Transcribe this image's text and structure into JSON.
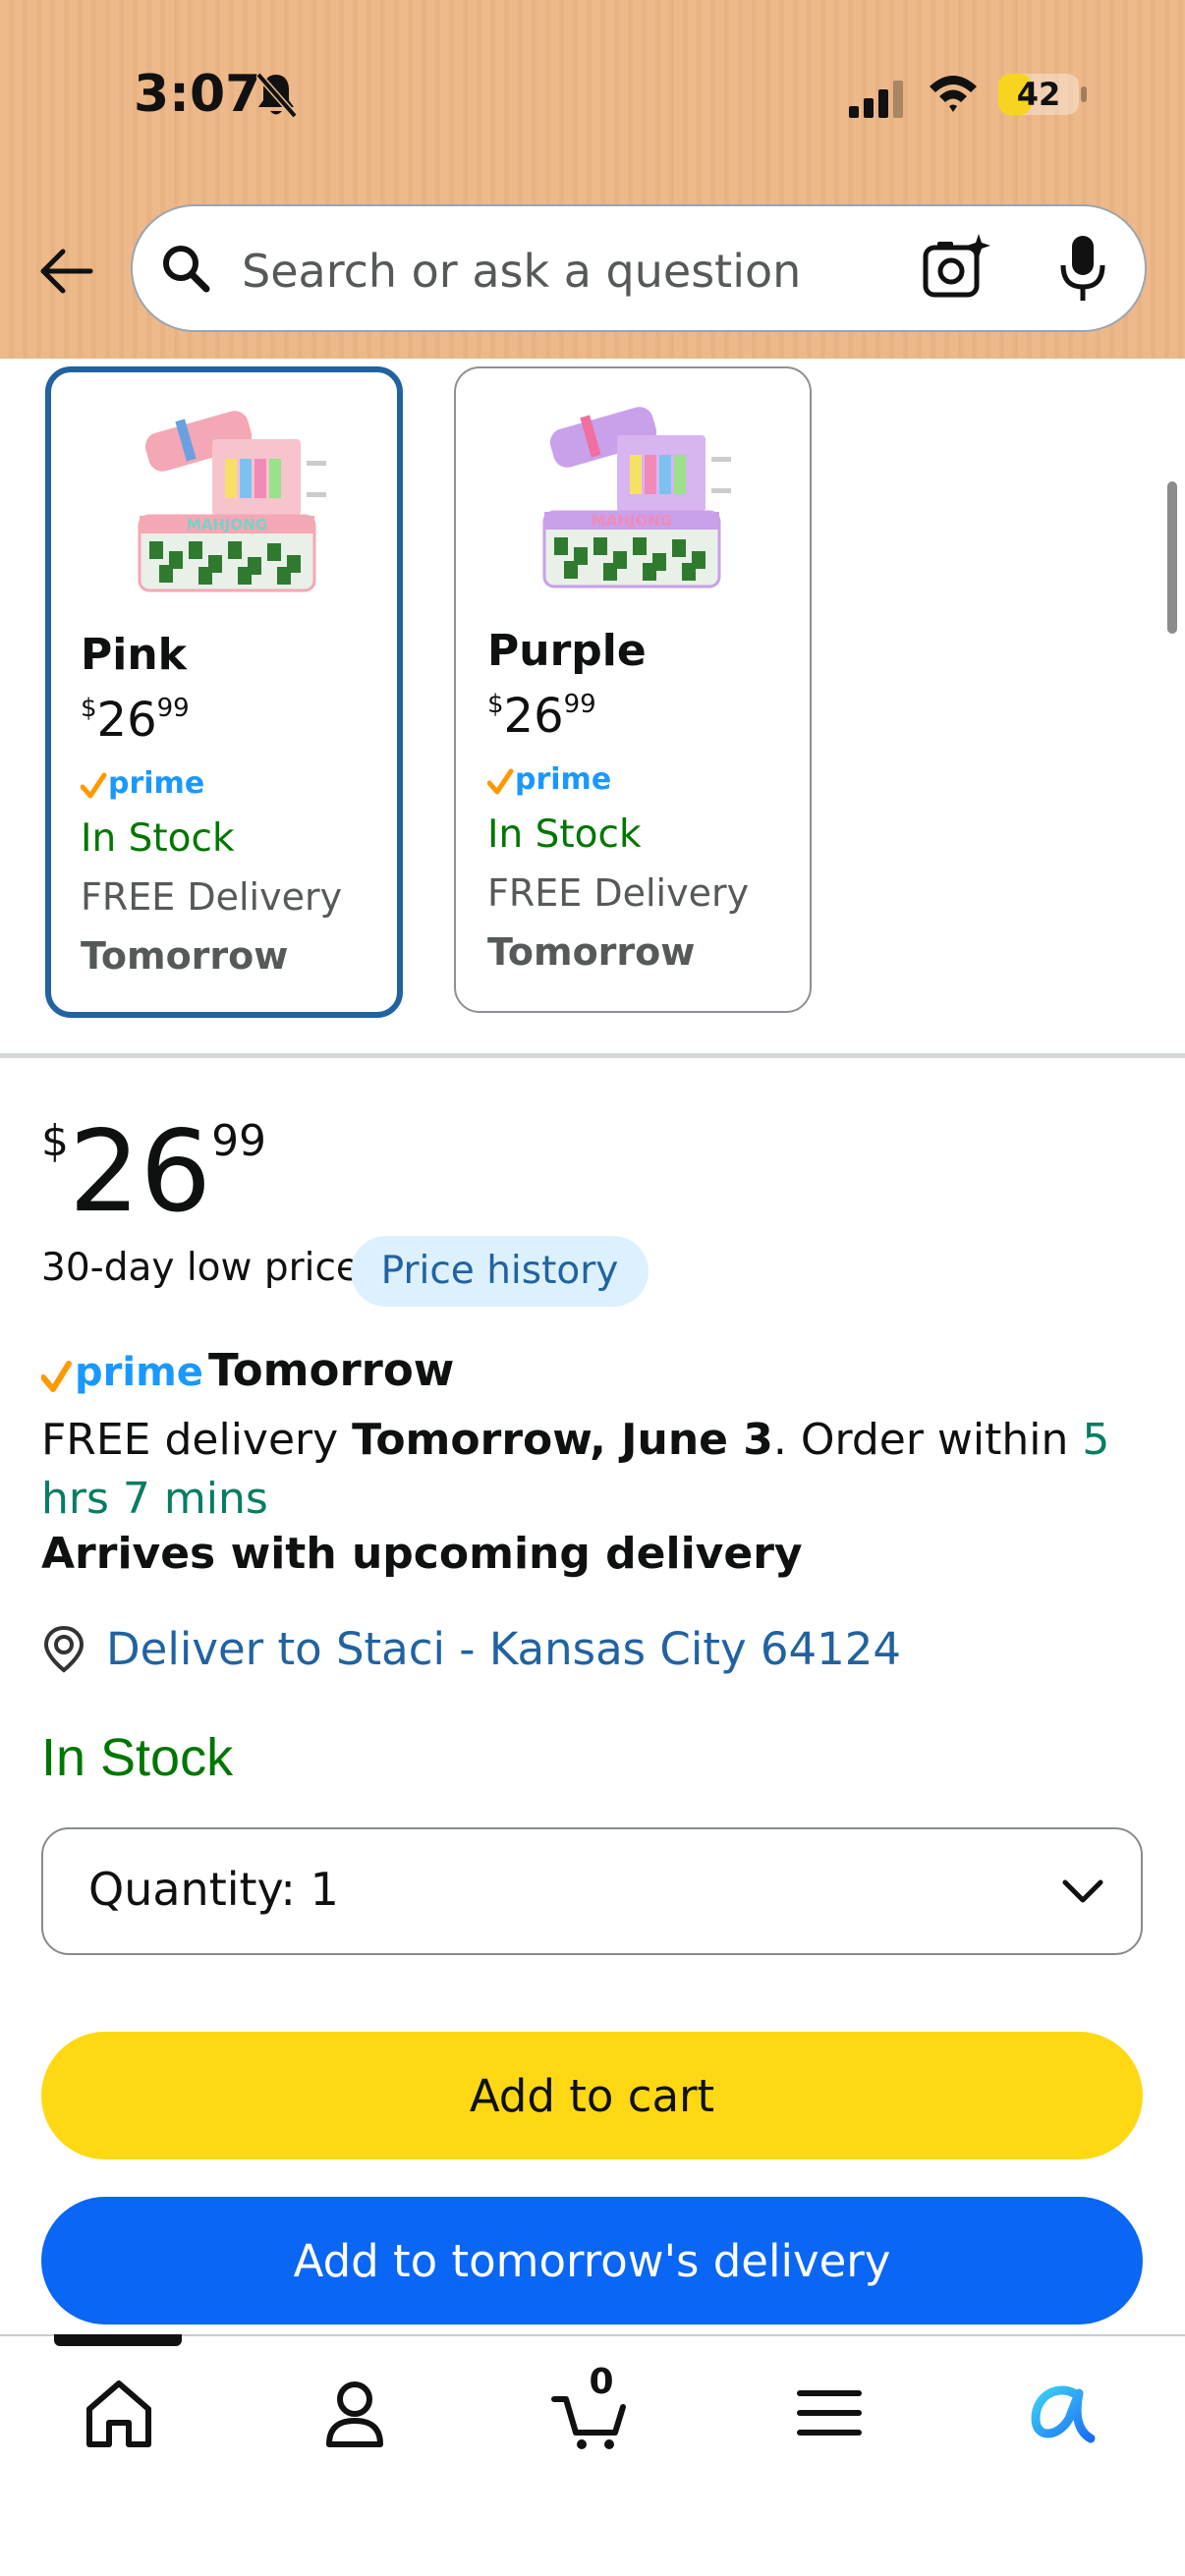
{
  "status_bar": {
    "time": "3:07",
    "battery": "42",
    "battery_level": 0.42
  },
  "search": {
    "placeholder": "Search or ask a question"
  },
  "variants": [
    {
      "name": "Pink",
      "price_symbol": "$",
      "price_whole": "26",
      "price_cents": "99",
      "stock": "In Stock",
      "delivery": "FREE Delivery",
      "delivery_day": "Tomorrow",
      "image_text": "MAHJONG",
      "selected": true
    },
    {
      "name": "Purple",
      "price_symbol": "$",
      "price_whole": "26",
      "price_cents": "99",
      "stock": "In Stock",
      "delivery": "FREE Delivery",
      "delivery_day": "Tomorrow",
      "image_text": "MAHJONG",
      "selected": false
    }
  ],
  "price": {
    "symbol": "$",
    "whole": "26",
    "cents": "99",
    "low_price_label": "30-day low price",
    "history_button": "Price history"
  },
  "delivery": {
    "prime_label": "Tomorrow",
    "line_prefix": "FREE delivery ",
    "date": "Tomorrow, June 3",
    "order_within_prefix": ". Order within ",
    "order_within": "5 hrs 7 mins",
    "arrives": "Arrives with upcoming delivery",
    "deliver_to": "Deliver to Staci - Kansas City 64124"
  },
  "stock_status": "In Stock",
  "quantity": {
    "label": "Quantity:",
    "value": "1"
  },
  "buttons": {
    "add_to_cart": "Add to cart",
    "add_to_tomorrow": "Add to tomorrow's delivery"
  },
  "bottom_nav": {
    "cart_count": "0",
    "items": [
      "home-icon",
      "account-icon",
      "cart-icon",
      "menu-icon",
      "rufus-icon"
    ]
  },
  "colors": {
    "header": "#edb98a",
    "prime_blue": "#1a98ff",
    "prime_check": "#ff9900",
    "stock_green": "#007600",
    "link_blue": "#2162a1",
    "cart_yellow": "#ffd814",
    "buy_blue": "#0a66f4"
  }
}
